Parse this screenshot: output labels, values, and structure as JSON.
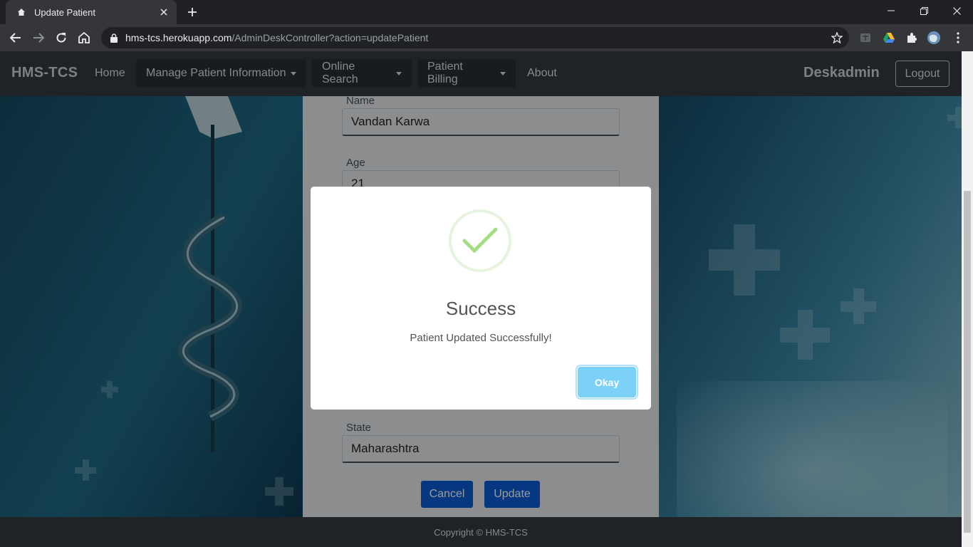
{
  "browser": {
    "tab_title": "Update Patient",
    "url_host": "hms-tcs.herokuapp.com",
    "url_path": "/AdminDeskController?action=updatePatient"
  },
  "navbar": {
    "brand": "HMS-TCS",
    "links": [
      "Home",
      "Manage Patient Information",
      "Online Search",
      "Patient Billing",
      "About"
    ],
    "user": "Deskadmin",
    "logout": "Logout"
  },
  "form": {
    "name_label": "Name",
    "name_value": "Vandan Karwa",
    "age_label": "Age",
    "age_value": "21",
    "state_label": "State",
    "state_value": "Maharashtra",
    "cancel": "Cancel",
    "update": "Update"
  },
  "footer": {
    "copyright": "Copyright © HMS-TCS"
  },
  "modal": {
    "title": "Success",
    "message": "Patient Updated Successfully!",
    "button": "Okay"
  },
  "colors": {
    "navbar": "#343a40",
    "primary_button": "#0b5ed7",
    "okay_button": "#7cd1f9",
    "success_check": "#a5dc86"
  }
}
